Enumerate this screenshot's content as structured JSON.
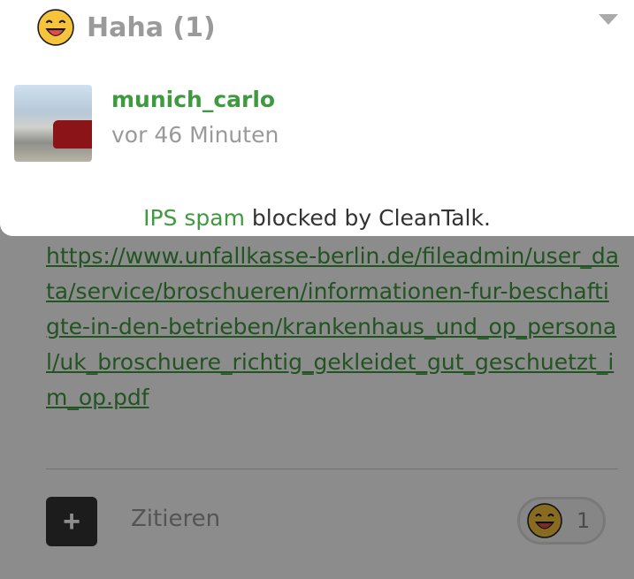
{
  "popup": {
    "title": "Haha (1)",
    "reaction_icon": "laughing-emoji-icon",
    "user": {
      "name": "munich_carlo",
      "time": "vor 46 Minuten"
    },
    "footer": {
      "link_text": "IPS spam",
      "text": " blocked by CleanTalk."
    }
  },
  "post": {
    "link_text": "https://www.unfallkasse-berlin.de/fileadmin/user_data/service/broschueren/informationen-fur-beschaftigte-in-den-betrieben/krankenhaus_und_op_personal/uk_broschuere_richtig_gekleidet_gut_geschuetzt_im_op.pdf",
    "quote_label": "Zitieren",
    "reaction_count": "1"
  },
  "colors": {
    "accent_green": "#3e9a3e",
    "muted_text": "#9a9a9a",
    "overlay": "rgba(0,0,0,0.45)"
  }
}
